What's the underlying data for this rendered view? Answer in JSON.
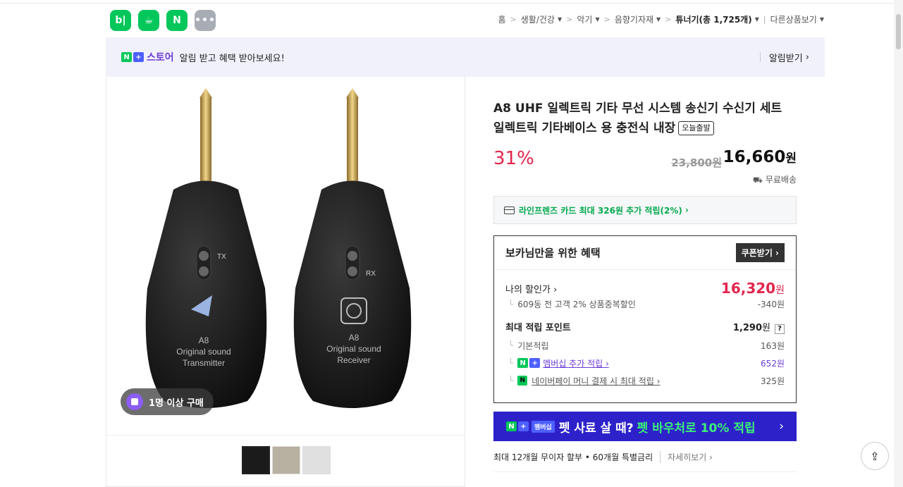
{
  "app_icons": [
    "b|",
    "☕",
    "N",
    "•••"
  ],
  "breadcrumb": {
    "home": "홈",
    "items": [
      "생활/건강",
      "악기",
      "음향기자재"
    ],
    "current": "튜너기(총 1,725개)",
    "other": "다른상품보기"
  },
  "alert": {
    "n_badge": "N",
    "plus_badge": "+",
    "store_word": "스토어",
    "text": "알림 받고 혜택 받아보세요!",
    "action": "알림받기"
  },
  "gallery": {
    "buyer_badge": "1명 이상 구매",
    "thumb_count": 3,
    "device_left": {
      "tag": "TX",
      "model": "A8",
      "line1": "Original sound",
      "line2": "Transmitter"
    },
    "device_right": {
      "tag": "RX",
      "model": "A8",
      "line1": "Original sound",
      "line2": "Receiver"
    }
  },
  "product": {
    "title": "A8 UHF 일렉트릭 기타 무선 시스템 송신기 수신기 세트 일렉트릭 기타베이스 용 충전식 내장",
    "today_tag": "오늘출발",
    "discount": "31%",
    "original_price": "23,800원",
    "final_price": "16,660",
    "won": "원",
    "shipping": "무료배송"
  },
  "card_benefit": "라인프렌즈 카드 최대 326원 추가 적립(2%)",
  "benefits": {
    "heading": "보카님만을 위한 혜택",
    "coupon_button": "쿠폰받기",
    "my_price_label": "나의 할인가",
    "my_price": "16,320",
    "my_price_unit": "원",
    "discount_detail": "609동 전 고객 2% 상품중복할인",
    "discount_amount": "-340원",
    "points_label": "최대 적립 포인트",
    "points_total": "1,290",
    "points_unit": "원",
    "qmark": "?",
    "basic_label": "기본적립",
    "basic_value": "163원",
    "membership_label": "멤버십 추가 적립",
    "membership_value": "652원",
    "npay_label": "네이버페이 머니 결제 시 최대 적립",
    "npay_value": "325원"
  },
  "pet_banner": {
    "membership": "멤버십",
    "text": "펫 사료 살 때?",
    "highlight": "펫 바우처로 10% 적립"
  },
  "installment": {
    "text": "최대 12개월 무이자 할부 • 60개월 특별금리",
    "more": "자세히보기"
  }
}
